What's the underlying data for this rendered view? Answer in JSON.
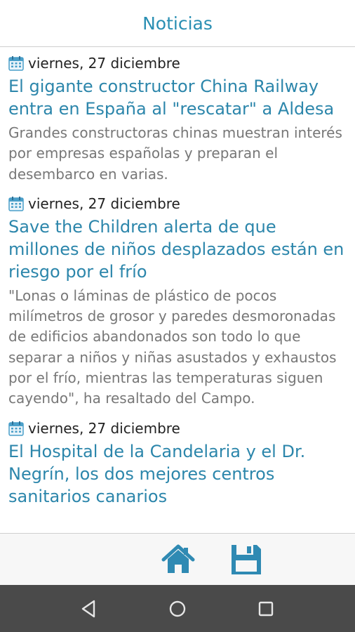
{
  "header": {
    "title": "Noticias"
  },
  "articles": [
    {
      "date": "viernes, 27 diciembre",
      "headline": "El gigante constructor China Railway entra en España al \"rescatar\" a Aldesa",
      "summary": "Grandes constructoras chinas muestran interés por empresas españolas y preparan el desembarco en varias."
    },
    {
      "date": "viernes, 27 diciembre",
      "headline": "Save the Children alerta de que millones de niños desplazados están en riesgo por el frío",
      "summary": "\"Lonas o láminas de plástico de pocos milímetros de grosor y paredes desmoronadas de edificios abandonados son todo lo que separar a niños y niñas asustados y exhaustos por el frío, mientras las temperaturas siguen cayendo\", ha resaltado del Campo."
    },
    {
      "date": "viernes, 27 diciembre",
      "headline": "El Hospital de la Candelaria y el Dr. Negrín, los dos mejores centros sanitarios canarios",
      "summary": ""
    }
  ],
  "icons": {
    "calendar": "calendar-icon",
    "home": "home-icon",
    "save": "save-icon",
    "back": "back-icon",
    "system_home": "circle-home-icon",
    "recents": "square-recents-icon"
  },
  "colors": {
    "accent": "#2c86ab",
    "title": "#2a8fb3",
    "summary_text": "#777777",
    "date_text": "#222222",
    "nav_bar": "#4a4a4a"
  }
}
